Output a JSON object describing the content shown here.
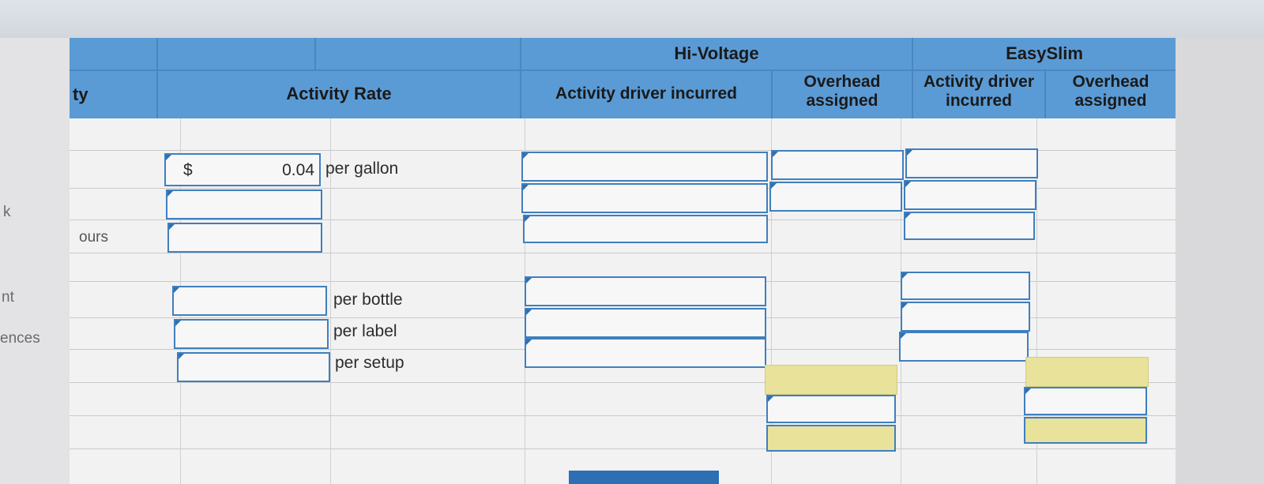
{
  "left_labels": {
    "row_a": "k",
    "row_b": "nt",
    "row_c": "ences"
  },
  "table": {
    "col_activity_partial": "ty",
    "col_activity_rate": "Activity Rate",
    "group_hi_voltage": "Hi-Voltage",
    "group_easyslim": "EasySlim",
    "hv_driver_incurred": "Activity driver incurred",
    "hv_overhead_line1": "Overhead",
    "hv_overhead_line2": "assigned",
    "es_driver_line1": "Activity driver",
    "es_driver_line2": "incurred",
    "es_overhead_line1": "Overhead",
    "es_overhead_line2": "assigned"
  },
  "rows": {
    "row3_label_partial": "ours",
    "rate_currency": "$",
    "rate_value": "0.04",
    "unit_gallon": "per gallon",
    "unit_bottle": "per bottle",
    "unit_label": "per label",
    "unit_setup": "per setup"
  },
  "colors": {
    "header_blue": "#5b9bd5",
    "input_border": "#3f7fbf",
    "total_yellow": "#e8e29a"
  }
}
